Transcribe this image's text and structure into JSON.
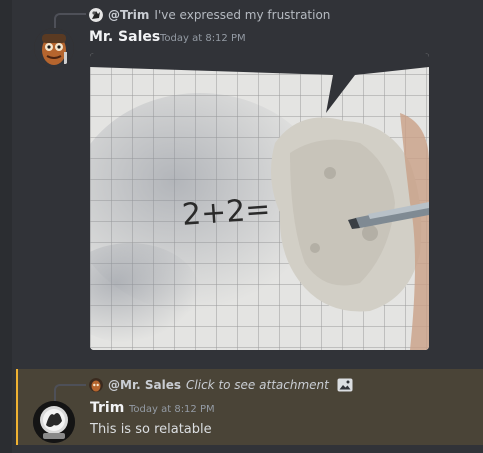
{
  "colors": {
    "background": "#313338",
    "highlight": "#4a4437",
    "highlight_bar": "#f0b232",
    "username": "#f2f3f5",
    "timestamp": "#949ba4"
  },
  "messages": [
    {
      "reply": {
        "author": "@Trim",
        "text": "I've expressed my frustration",
        "avatar_icon": "trim-avatar-icon"
      },
      "author": "Mr. Sales",
      "timestamp": "Today at 8:12 PM",
      "avatar_icon": "mr-sales-avatar",
      "attachment": {
        "type": "image",
        "equation_text": "2+2=",
        "icon": "speech-bubble-meme-image"
      }
    },
    {
      "reply": {
        "author": "@Mr. Sales",
        "text": "Click to see attachment",
        "avatar_icon": "mr-sales-avatar-icon",
        "attachment_icon": "image-icon"
      },
      "author": "Trim",
      "timestamp": "Today at 8:12 PM",
      "avatar_icon": "trim-avatar",
      "content": "This is so relatable"
    }
  ]
}
